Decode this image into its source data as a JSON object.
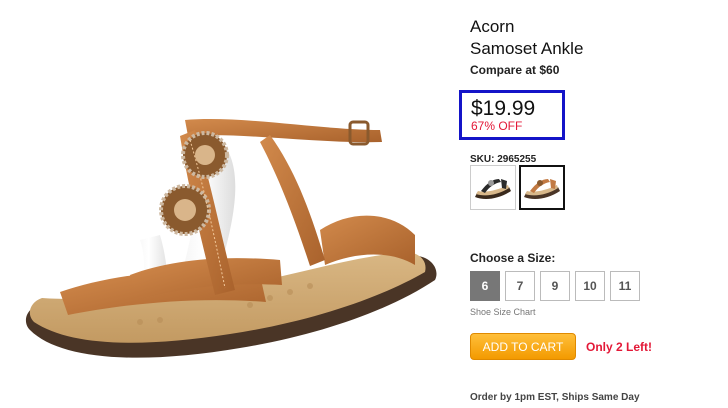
{
  "product": {
    "brand": "Acorn",
    "model": "Samoset Ankle",
    "compare_price": "Compare at $60",
    "price": "$19.99",
    "discount": "67% OFF",
    "sku_label": "SKU: 2965255",
    "highlight_color": "#1414c8",
    "alert_color": "#e31837"
  },
  "image": {
    "alt": "Brown T-strap sandal with beaded medallions",
    "icon": "sandal-photo"
  },
  "swatches": [
    {
      "name": "black",
      "color": "#2b2b2b",
      "selected": false
    },
    {
      "name": "brown",
      "color": "#c27a43",
      "selected": true
    }
  ],
  "sizes": {
    "heading": "Choose a Size:",
    "options": [
      "6",
      "7",
      "9",
      "10",
      "11"
    ],
    "selected": "6",
    "chart_link": "Shoe Size Chart"
  },
  "cart": {
    "button_label": "ADD TO CART",
    "button_color": "#f5a623",
    "stock_text": "Only 2 Left!"
  },
  "shipping": {
    "note": "Order by 1pm EST, Ships Same Day"
  }
}
